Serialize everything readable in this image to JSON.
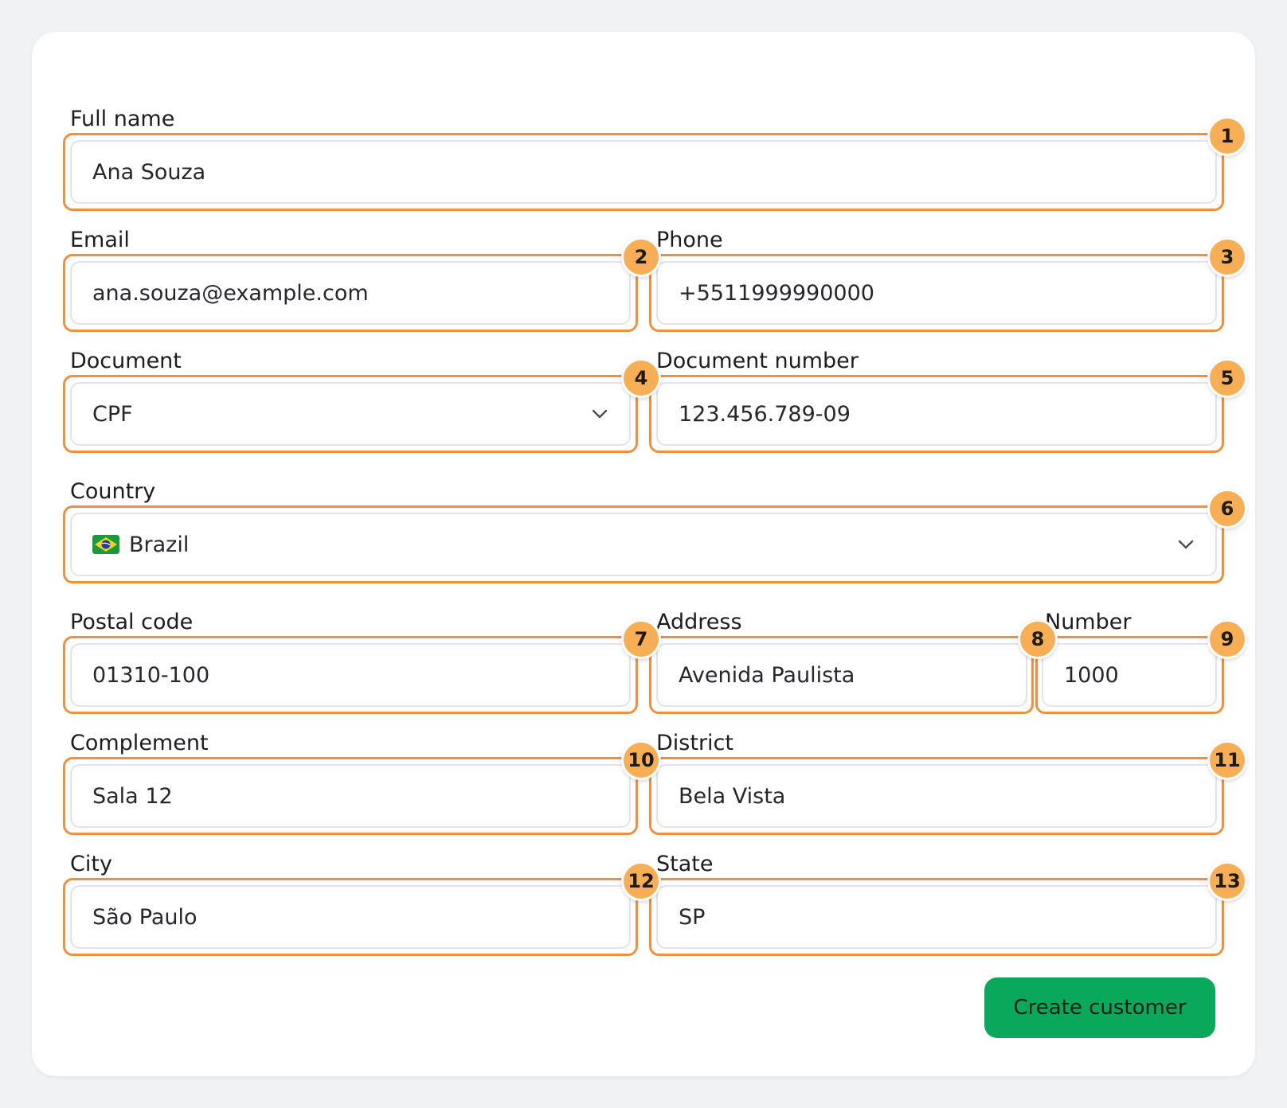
{
  "form": {
    "full_name": {
      "label": "Full name",
      "value": "Ana Souza",
      "badge": "1"
    },
    "email": {
      "label": "Email",
      "value": "ana.souza@example.com",
      "badge": "2"
    },
    "phone": {
      "label": "Phone",
      "value": "+5511999990000",
      "badge": "3"
    },
    "document": {
      "label": "Document",
      "value": "CPF",
      "badge": "4"
    },
    "document_number": {
      "label": "Document number",
      "value": "123.456.789-09",
      "badge": "5"
    },
    "country": {
      "label": "Country",
      "value": "Brazil",
      "flag_icon": "brazil-flag-icon",
      "badge": "6"
    },
    "postal_code": {
      "label": "Postal code",
      "value": "01310-100",
      "badge": "7"
    },
    "address": {
      "label": "Address",
      "value": "Avenida Paulista",
      "badge": "8"
    },
    "number": {
      "label": "Number",
      "value": "1000",
      "badge": "9"
    },
    "complement": {
      "label": "Complement",
      "value": "Sala 12",
      "badge": "10"
    },
    "district": {
      "label": "District",
      "value": "Bela Vista",
      "badge": "11"
    },
    "city": {
      "label": "City",
      "value": "São Paulo",
      "badge": "12"
    },
    "state": {
      "label": "State",
      "value": "SP",
      "badge": "13"
    }
  },
  "submit": {
    "label": "Create customer"
  },
  "colors": {
    "highlight": "#f08f3c",
    "badge": "#f7ae55",
    "primary_button": "#0aa85a",
    "page_bg": "#f1f2f4"
  },
  "icons": {
    "dropdown": "chevron-down-icon"
  }
}
